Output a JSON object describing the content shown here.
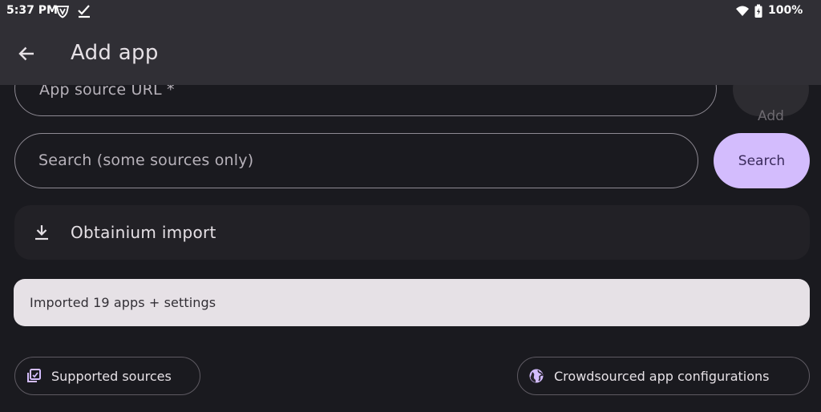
{
  "status_bar": {
    "time": "5:37 PM",
    "battery": "100%",
    "icons": [
      "vpn-shield-icon",
      "checkmark-icon",
      "wifi-icon",
      "battery-icon"
    ]
  },
  "app_bar": {
    "title": "Add app",
    "back_icon": "arrow-back-icon"
  },
  "form": {
    "url_placeholder": "App source URL *",
    "add_label": "Add",
    "search_placeholder": "Search (some sources only)",
    "search_label": "Search"
  },
  "import_tile": {
    "label": "Obtainium import",
    "icon": "download-icon"
  },
  "snackbar": {
    "text": "Imported 19 apps + settings"
  },
  "chips": {
    "sources_label": "Supported sources",
    "sources_icon": "library-icon",
    "crowd_label": "Crowdsourced app configurations",
    "crowd_icon": "globe-icon"
  },
  "colors": {
    "background": "#1a1a1f",
    "app_bar": "#302f35",
    "accent": "#d3bcfd",
    "snackbar": "#e6e1e6"
  }
}
